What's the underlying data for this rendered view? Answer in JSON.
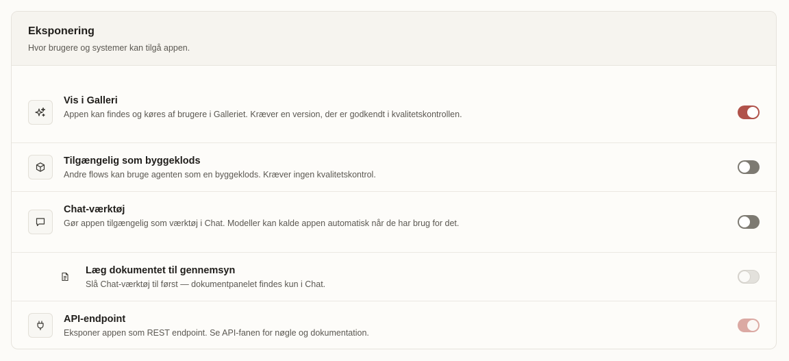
{
  "section": {
    "title": "Eksponering",
    "subtitle": "Hvor brugere og systemer kan tilgå appen."
  },
  "rows": [
    {
      "title": "Vis i Galleri",
      "description": "Appen kan findes og køres af brugere i Galleriet. Kræver en version, der er godkendt i kvalitetskontrollen.",
      "icon": "sparkles-icon",
      "enabled": true,
      "disabled": false
    },
    {
      "title": "Tilgængelig som byggeklods",
      "description": "Andre flows kan bruge agenten som en byggeklods. Kræver ingen kvalitetskontrol.",
      "icon": "cube-icon",
      "enabled": false,
      "disabled": false
    },
    {
      "title": "Chat-værktøj",
      "description": "Gør appen tilgængelig som værktøj i Chat. Modeller kan kalde appen automatisk når de har brug for det.",
      "icon": "chat-bubble-icon",
      "enabled": false,
      "disabled": false
    },
    {
      "title": "Læg dokumentet til gennemsyn",
      "description": "Slå Chat-værktøj til først — dokumentpanelet findes kun i Chat.",
      "icon": "document-icon",
      "enabled": false,
      "disabled": true
    },
    {
      "title": "API-endpoint",
      "description": "Eksponer appen som REST endpoint. Se API-fanen for nøgle og dokumentation.",
      "icon": "plug-icon",
      "enabled": true,
      "disabled": true
    }
  ],
  "colors": {
    "toggle_on": "#b0524a",
    "toggle_off": "#7d7a72",
    "toggle_on_disabled": "#dba9a3",
    "toggle_off_disabled": "#e3e1dc"
  }
}
